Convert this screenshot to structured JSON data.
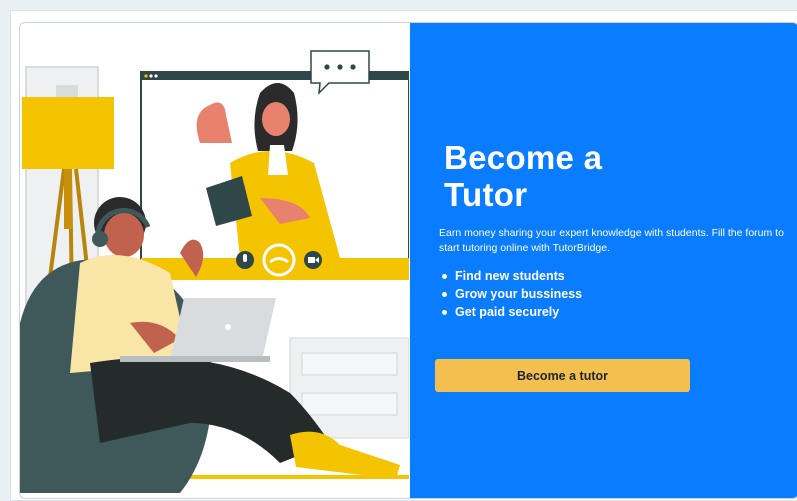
{
  "hero": {
    "title_line1": "Become a",
    "title_line2": "Tutor",
    "description": "Earn money sharing your expert knowledge with students. Fill the forum to start tutoring online with TutorBridge.",
    "features": [
      "Find new students",
      "Grow your bussiness",
      "Get paid securely"
    ],
    "cta_label": "Become a tutor",
    "speech_bubble_text": "• • •"
  },
  "colors": {
    "panel_blue": "#0a7cff",
    "cta_yellow": "#f3c04f",
    "accent_yellow": "#f5c400",
    "dark_teal": "#2f4749"
  },
  "icons": [
    "microphone-icon",
    "end-call-icon",
    "video-camera-icon",
    "ellipsis-icon"
  ]
}
